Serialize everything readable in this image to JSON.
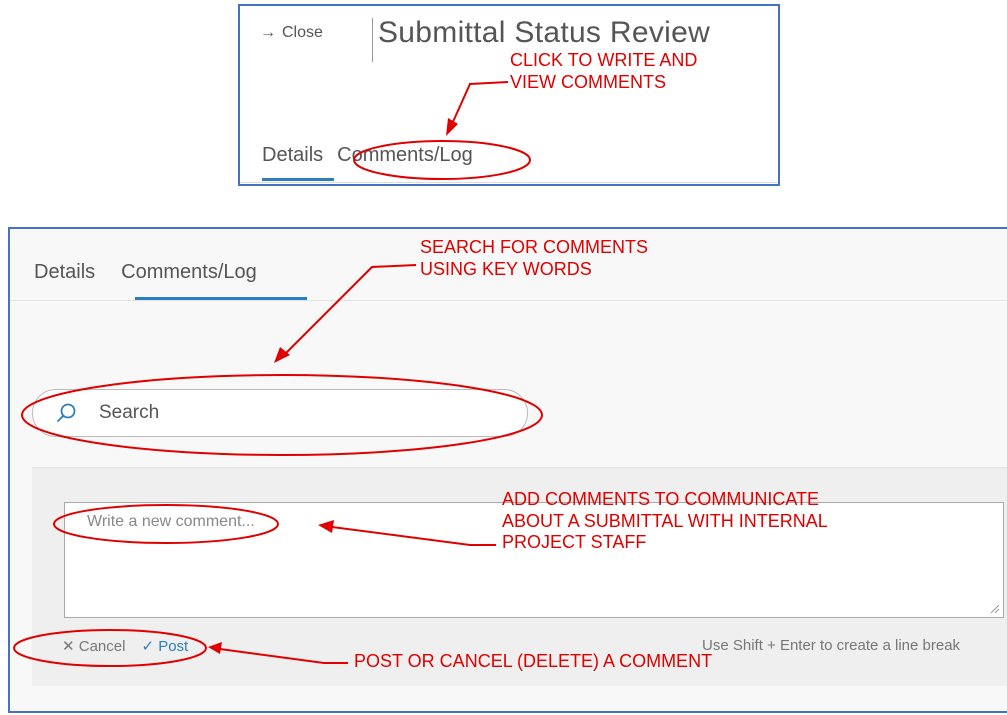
{
  "header": {
    "close_label": "Close",
    "title": "Submittal Status Review"
  },
  "tabs": [
    "Details",
    "Comments/Log"
  ],
  "search": {
    "placeholder": "Search"
  },
  "comment": {
    "placeholder": "Write a new comment..."
  },
  "actions": {
    "cancel_label": "Cancel",
    "post_label": "Post",
    "hint": "Use Shift + Enter to create a line break"
  },
  "annotations": {
    "a1": [
      "CLICK TO WRITE AND",
      "VIEW COMMENTS"
    ],
    "a2": [
      "SEARCH FOR COMMENTS",
      "USING KEY WORDS"
    ],
    "a3": [
      "ADD COMMENTS TO COMMUNICATE",
      "ABOUT A SUBMITTAL WITH INTERNAL",
      "PROJECT STAFF"
    ],
    "a4": "POST OR CANCEL (DELETE) A COMMENT"
  },
  "colors": {
    "accent": "#2b7fc1",
    "annotation": "#e00000",
    "frame": "#4472c4"
  }
}
